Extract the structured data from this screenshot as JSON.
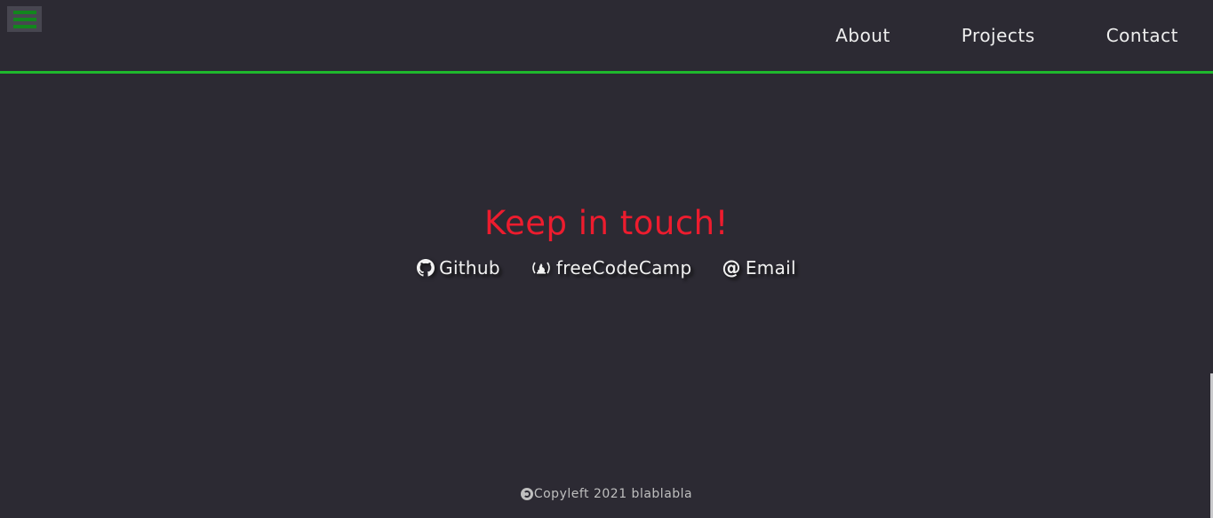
{
  "nav": {
    "menu_icon": "hamburger-menu-icon",
    "links": [
      {
        "label": "About"
      },
      {
        "label": "Projects"
      },
      {
        "label": "Contact"
      }
    ]
  },
  "contact": {
    "title": "Keep in touch!",
    "links": [
      {
        "label": "Github",
        "icon": "github-icon"
      },
      {
        "label": "freeCodeCamp",
        "icon": "freecodecamp-icon"
      },
      {
        "label": "Email",
        "icon": "at-sign-icon"
      }
    ]
  },
  "footer": {
    "icon": "copyleft-icon",
    "text": "Copyleft 2021 blablabla"
  },
  "colors": {
    "background": "#2c2a33",
    "accent_green": "#1fb82d",
    "title_red": "#ed1c2e",
    "text": "#f2f2f2"
  }
}
